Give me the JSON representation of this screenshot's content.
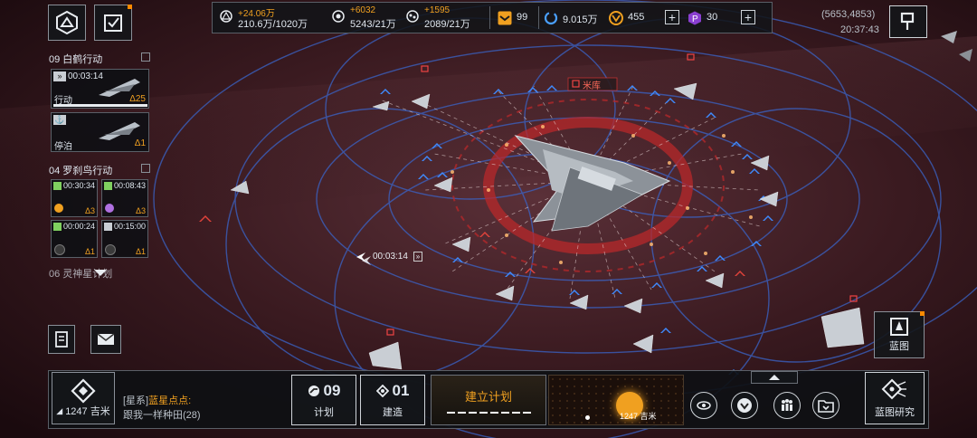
{
  "resources": [
    {
      "icon": "metal-icon",
      "delta": "+24.06万",
      "value": "210.6万/1020万"
    },
    {
      "icon": "crystal-icon",
      "delta": "+6032",
      "value": "5243/21万"
    },
    {
      "icon": "deuterium-icon",
      "delta": "+1595",
      "value": "2089/21万"
    }
  ],
  "currencies": [
    {
      "icon": "chevron-badge-icon",
      "value": "99"
    },
    {
      "icon": "cycle-icon",
      "value": "9.015万"
    },
    {
      "icon": "gold-coin-icon",
      "value": "455"
    },
    {
      "icon": "purple-p-icon",
      "value": "30"
    }
  ],
  "coords": "(5653,4853)",
  "clock": "20:37:43",
  "fleet_groups": [
    {
      "title": "09 白鹤行动",
      "cards": [
        {
          "timer": "00:03:14",
          "status": "行动",
          "count": "25"
        },
        {
          "status": "停泊",
          "count": "1"
        }
      ]
    },
    {
      "title": "04 罗刹鸟行动",
      "minis": [
        {
          "timer": "00:30:34",
          "count": "3"
        },
        {
          "timer": "00:08:43",
          "count": "3"
        },
        {
          "timer": "00:00:24",
          "count": "1"
        },
        {
          "timer": "00:15:00",
          "count": "1"
        }
      ]
    },
    {
      "title": "06 灵神星计划"
    }
  ],
  "map": {
    "station_label": "米库",
    "fleet_timer": "00:03:14"
  },
  "bottom": {
    "distance": "1247 吉米",
    "chat_channel": "[星系]",
    "chat_user": "蓝星点点:",
    "chat_message": "跟我一样种田(28)",
    "plan_count": "09",
    "plan_label": "计划",
    "build_count": "01",
    "build_label": "建造",
    "establish_plan": "建立计划",
    "minimap_distance": "1247 吉米",
    "blueprint_research": "蓝图研究",
    "blueprint": "蓝图"
  },
  "colors": {
    "accent": "#f0a020",
    "friendly": "#3f8bff",
    "enemy": "#e2433b",
    "orbit": "#3a64c8"
  }
}
